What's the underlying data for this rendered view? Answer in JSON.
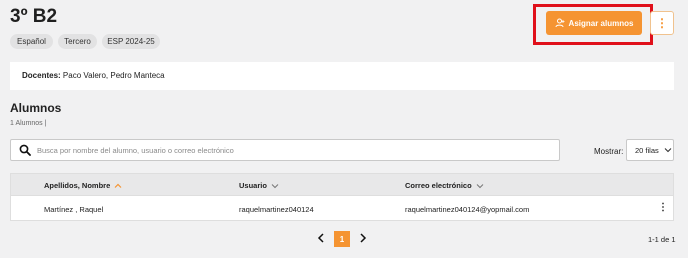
{
  "header": {
    "title": "3º B2",
    "tags": [
      "Español",
      "Tercero",
      "ESP 2024-25"
    ],
    "assign_label": "Asignar alumnos",
    "more_glyph": "⋮"
  },
  "teachers": {
    "label": "Docentes:",
    "names": "Paco Valero, Pedro Manteca"
  },
  "students": {
    "heading": "Alumnos",
    "count": "1 Alumnos |"
  },
  "search": {
    "placeholder": "Busca por nombre del alumno, usuario o correo electrónico",
    "value": ""
  },
  "rows_control": {
    "label": "Mostrar:",
    "selected": "20 filas"
  },
  "table": {
    "columns": [
      "Apellidos, Nombre",
      "Usuario",
      "Correo electrónico"
    ],
    "rows": [
      {
        "name": "Martínez , Raquel",
        "user": "raquelmartinez040124",
        "email": "raquelmartinez040124@yopmail.com"
      }
    ],
    "row_more_glyph": "⋮"
  },
  "pagination": {
    "current": "1",
    "range": "1-1 de 1"
  },
  "colors": {
    "accent": "#f59432",
    "highlight": "#e0101b",
    "background": "#f1f1f2"
  },
  "icons": [
    "user-add-icon",
    "more-vertical-icon",
    "search-icon",
    "chevron-down-icon",
    "sort-asc-icon",
    "chevron-left-icon",
    "chevron-right-icon"
  ]
}
